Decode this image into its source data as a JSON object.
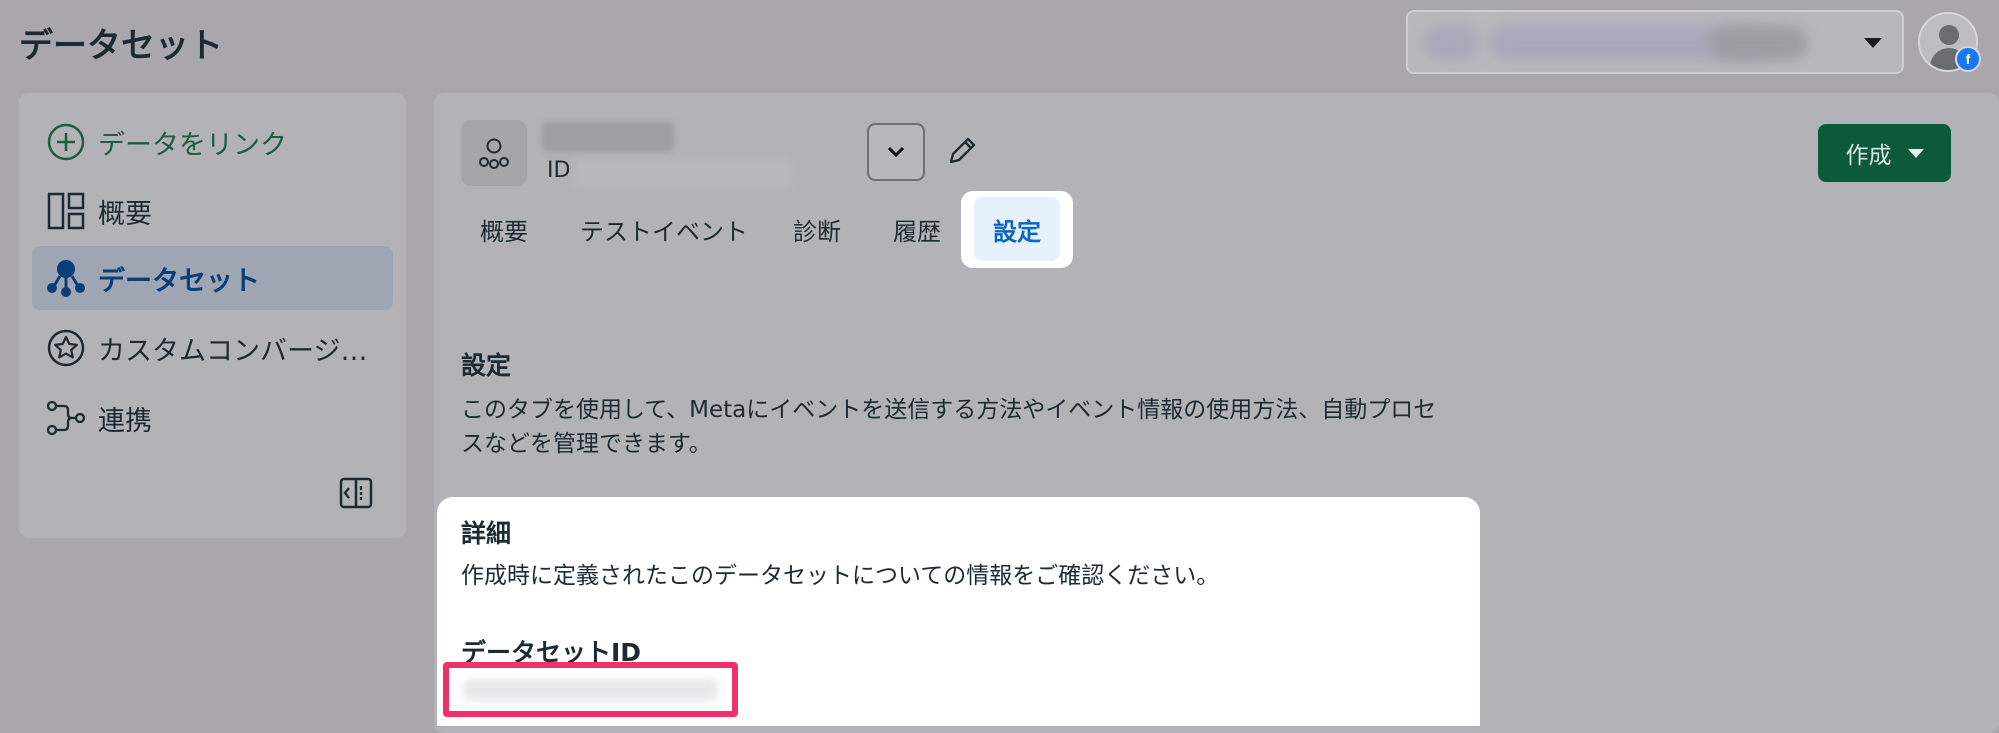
{
  "header": {
    "title": "データセット"
  },
  "sidebar": {
    "items": [
      {
        "label": "データをリンク",
        "icon": "plus-circle-icon"
      },
      {
        "label": "概要",
        "icon": "layout-icon"
      },
      {
        "label": "データセット",
        "icon": "dataset-icon"
      },
      {
        "label": "カスタムコンバージ…",
        "icon": "star-circle-icon"
      },
      {
        "label": "連携",
        "icon": "integration-icon"
      }
    ],
    "active_index": 2
  },
  "dataset": {
    "id_label": "ID"
  },
  "toolbar": {
    "create_label": "作成"
  },
  "tabs": [
    {
      "label": "概要"
    },
    {
      "label": "テストイベント"
    },
    {
      "label": "診断"
    },
    {
      "label": "履歴"
    },
    {
      "label": "設定"
    }
  ],
  "active_tab_index": 4,
  "settings": {
    "title": "設定",
    "description": "このタブを使用して、Metaにイベントを送信する方法やイベント情報の使用方法、自動プロセスなどを管理できます。"
  },
  "details": {
    "title": "詳細",
    "description": "作成時に定義されたこのデータセットについての情報をご確認ください。",
    "dataset_id_label": "データセットID"
  },
  "colors": {
    "accent_green": "#0d5a3b",
    "active_tab_blue": "#0a66c2",
    "highlight_pink": "#f0306a"
  }
}
